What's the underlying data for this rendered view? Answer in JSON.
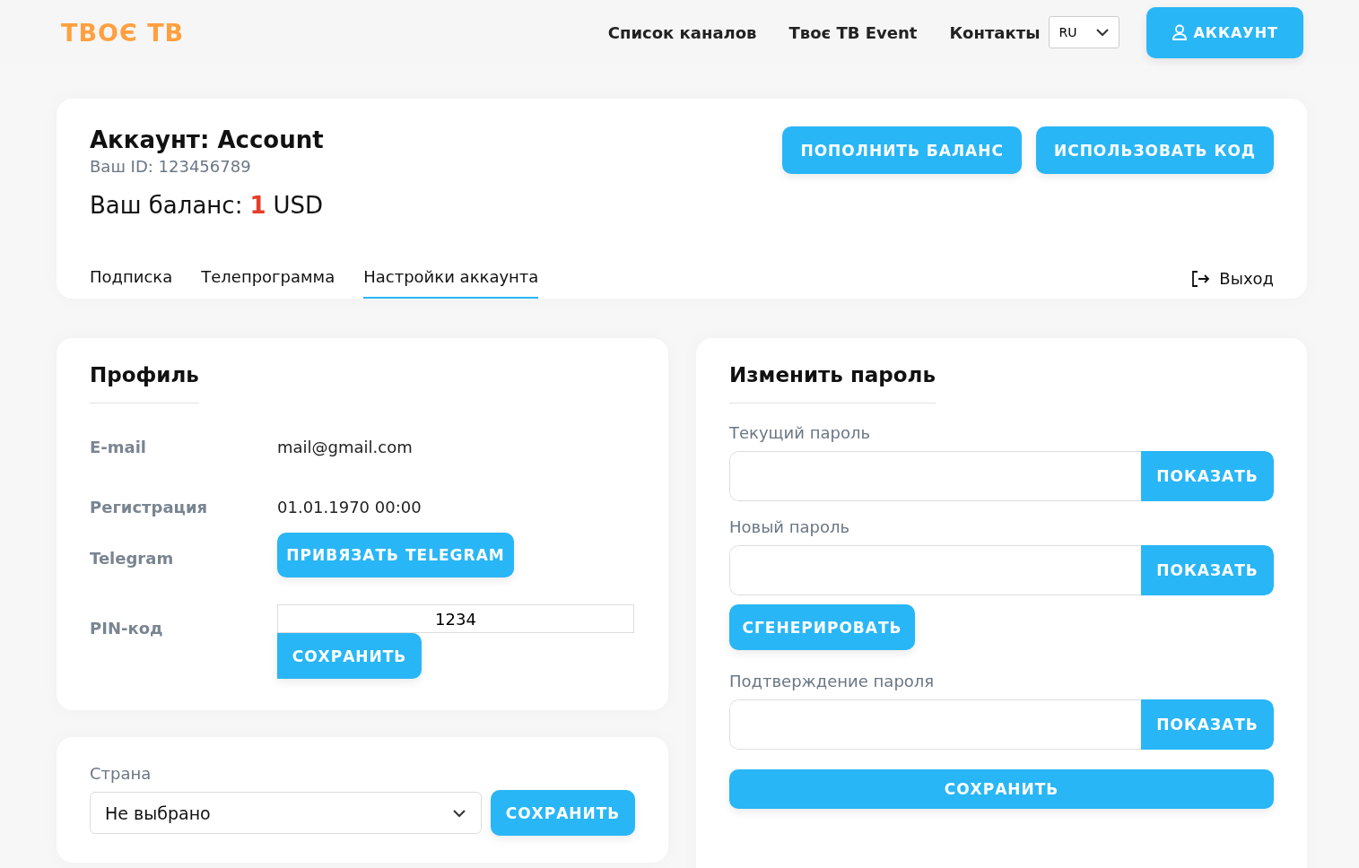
{
  "header": {
    "logo": "ТВОЄ ТВ",
    "nav": [
      "Список каналов",
      "Твоє ТВ Event",
      "Контакты"
    ],
    "language": "RU",
    "account_button": "АККАУНТ"
  },
  "account": {
    "title": "Аккаунт: Account",
    "id": "Ваш ID: 123456789",
    "balance_label": "Ваш баланс:",
    "balance_amount": "1",
    "balance_currency": "USD",
    "buttons": [
      "ПОПОЛНИТЬ БАЛАНС",
      "ИСПОЛЬЗОВАТЬ КОД"
    ],
    "tabs": [
      {
        "label": "Подписка",
        "selected": false
      },
      {
        "label": "Телепрограмма",
        "selected": false
      },
      {
        "label": "Настройки аккаунта",
        "selected": true
      }
    ],
    "logout": "Выход"
  },
  "profile": {
    "title": "Профиль",
    "rows": [
      {
        "kind": "text",
        "label": "E-mail",
        "value": "mail@gmail.com"
      },
      {
        "kind": "text",
        "label": "Регистрация",
        "value": "01.01.1970 00:00"
      },
      {
        "kind": "button",
        "label": "Telegram",
        "value": "ПРИВЯЗАТЬ TELEGRAM"
      },
      {
        "kind": "input",
        "label": "PIN-код",
        "value": "1234",
        "button": "СОХРАНИТЬ"
      }
    ]
  },
  "country": {
    "label": "Страна",
    "value": "Не выбрано",
    "button": "СОХРАНИТЬ"
  },
  "password": {
    "title": "Изменить пароль",
    "fields": [
      {
        "label": "Текущий пароль",
        "button": "ПОКАЗАТЬ"
      },
      {
        "label": "Новый пароль",
        "button": "ПОКАЗАТЬ",
        "extra_button": "СГЕНЕРИРОВАТЬ"
      },
      {
        "label": "Подтверждение пароля",
        "button": "ПОКАЗАТЬ"
      }
    ],
    "save_button": "СОХРАНИТЬ"
  }
}
